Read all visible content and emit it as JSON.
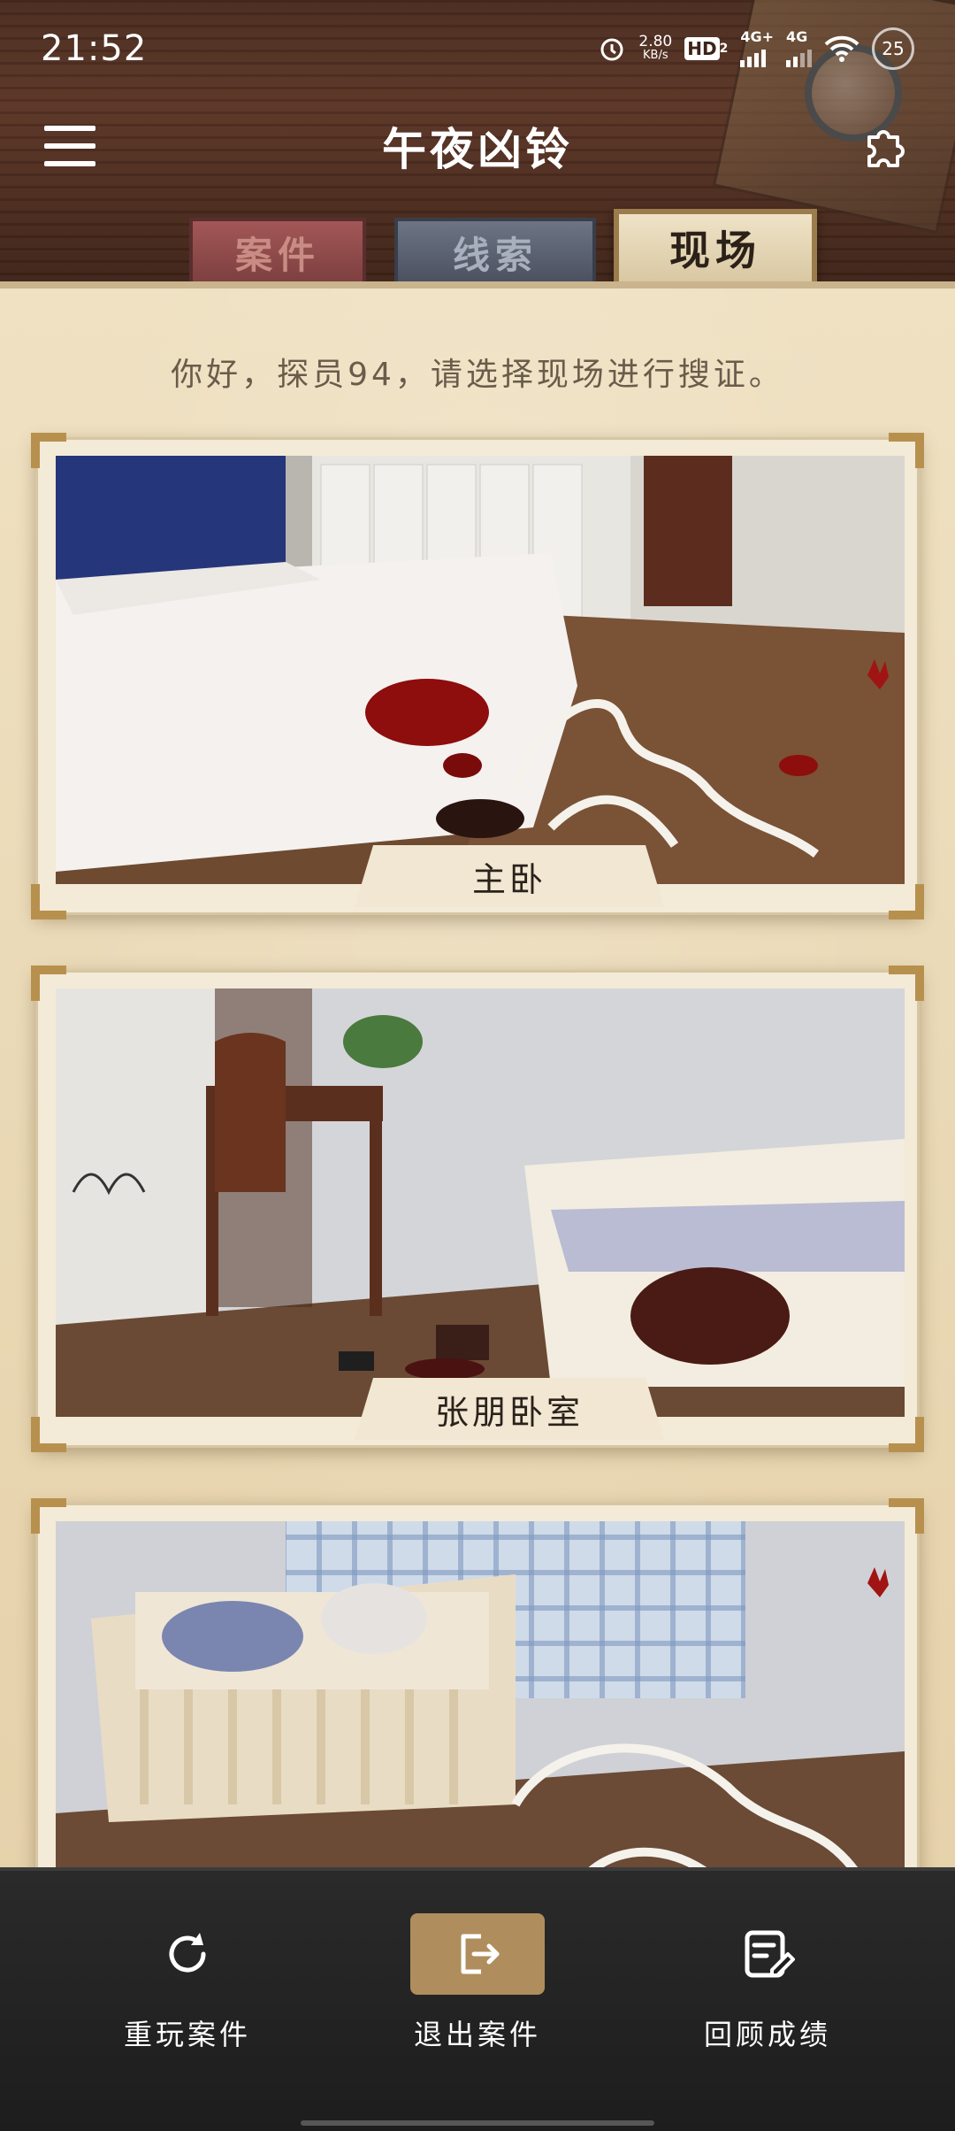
{
  "status_bar": {
    "time": "21:52",
    "net_speed_value": "2.80",
    "net_speed_unit": "KB/s",
    "hd_label": "HD",
    "hd_sub": "2",
    "net_4g_plus": "4G+",
    "net_4g": "4G",
    "battery": "25",
    "icons": [
      "alarm-icon",
      "hd-icon",
      "signal-4g-plus-icon",
      "signal-4g-icon",
      "wifi-icon",
      "battery-icon"
    ]
  },
  "header": {
    "title": "午夜凶铃",
    "menu_icon": "menu-icon",
    "puzzle_icon": "puzzle-icon"
  },
  "tabs": [
    {
      "label": "案件",
      "active": false
    },
    {
      "label": "线索",
      "active": false
    },
    {
      "label": "现场",
      "active": true
    }
  ],
  "main": {
    "greeting": "你好，探员94，请选择现场进行搜证。",
    "scenes": [
      {
        "label": "主卧"
      },
      {
        "label": "张朋卧室"
      },
      {
        "label": ""
      }
    ]
  },
  "bottom_bar": {
    "buttons": [
      {
        "label": "重玩案件",
        "icon": "replay-icon",
        "active": false
      },
      {
        "label": "退出案件",
        "icon": "exit-icon",
        "active": true
      },
      {
        "label": "回顾成绩",
        "icon": "review-icon",
        "active": false
      }
    ]
  },
  "colors": {
    "accent_gold": "#b08d5c",
    "paper": "#ead9b6",
    "wood": "#4a2c1f",
    "blood": "#8e0d0d"
  }
}
